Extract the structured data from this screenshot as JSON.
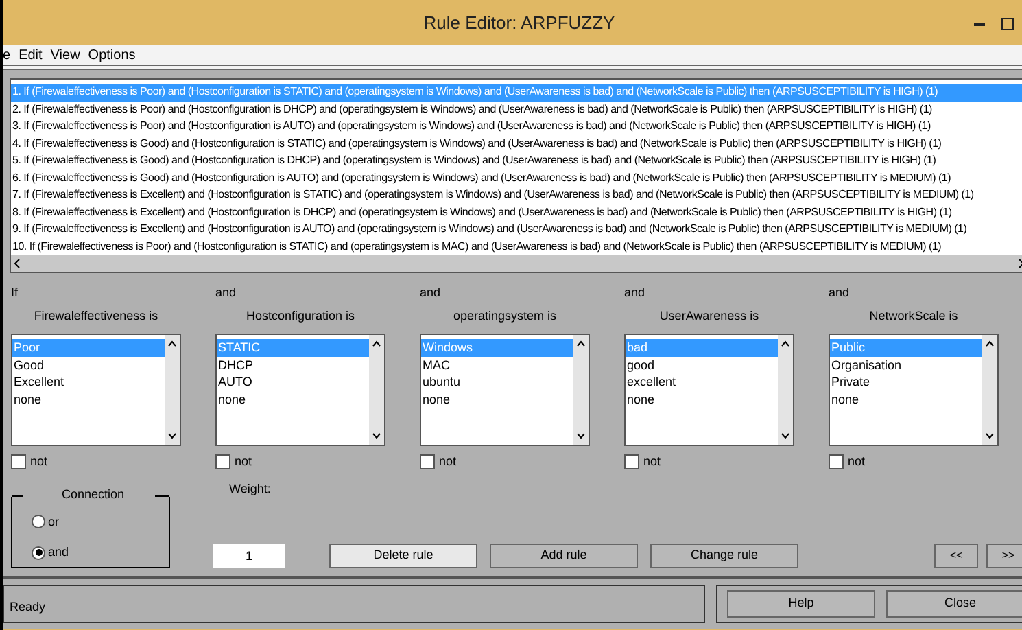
{
  "window": {
    "title": "Rule Editor: ARPFUZZY"
  },
  "menu": [
    "e",
    "Edit",
    "View",
    "Options"
  ],
  "rules": [
    {
      "text": "1. If (Firewaleffectiveness is Poor) and (Hostconfiguration is STATIC) and (operatingsystem is Windows) and (UserAwareness is bad) and (NetworkScale is Public) then (ARPSUSCEPTIBILITY is HIGH) (1)",
      "selected": true
    },
    {
      "text": "2. If (Firewaleffectiveness is Poor) and (Hostconfiguration is DHCP) and (operatingsystem is Windows) and (UserAwareness is bad) and (NetworkScale is Public) then (ARPSUSCEPTIBILITY is HIGH) (1)",
      "selected": false
    },
    {
      "text": "3. If (Firewaleffectiveness is Poor) and (Hostconfiguration is AUTO) and (operatingsystem is Windows) and (UserAwareness is bad) and (NetworkScale is Public) then (ARPSUSCEPTIBILITY is HIGH) (1)",
      "selected": false
    },
    {
      "text": "4. If (Firewaleffectiveness is Good) and (Hostconfiguration is STATIC) and (operatingsystem is Windows) and (UserAwareness is bad) and (NetworkScale is Public) then (ARPSUSCEPTIBILITY is HIGH) (1)",
      "selected": false
    },
    {
      "text": "5. If (Firewaleffectiveness is Good) and (Hostconfiguration is DHCP) and (operatingsystem is Windows) and (UserAwareness is bad) and (NetworkScale is Public) then (ARPSUSCEPTIBILITY is HIGH) (1)",
      "selected": false
    },
    {
      "text": "6. If (Firewaleffectiveness is Good) and (Hostconfiguration is AUTO) and (operatingsystem is Windows) and (UserAwareness is bad) and (NetworkScale is Public) then (ARPSUSCEPTIBILITY is MEDIUM) (1)",
      "selected": false
    },
    {
      "text": "7. If (Firewaleffectiveness is Excellent) and (Hostconfiguration is STATIC) and (operatingsystem is Windows) and (UserAwareness is bad) and (NetworkScale is Public) then (ARPSUSCEPTIBILITY is MEDIUM) (1)",
      "selected": false
    },
    {
      "text": "8. If (Firewaleffectiveness is Excellent) and (Hostconfiguration is DHCP) and (operatingsystem is Windows) and (UserAwareness is bad) and (NetworkScale is Public) then (ARPSUSCEPTIBILITY is HIGH) (1)",
      "selected": false
    },
    {
      "text": "9. If (Firewaleffectiveness is Excellent) and (Hostconfiguration is AUTO) and (operatingsystem is Windows) and (UserAwareness is bad) and (NetworkScale is Public) then (ARPSUSCEPTIBILITY is MEDIUM) (1)",
      "selected": false
    },
    {
      "text": "10. If (Firewaleffectiveness is Poor) and (Hostconfiguration is STATIC) and (operatingsystem is MAC) and (UserAwareness is bad) and (NetworkScale is Public) then (ARPSUSCEPTIBILITY is MEDIUM) (1)",
      "selected": false
    }
  ],
  "inputs": [
    {
      "connector": "If",
      "label": "Firewaleffectiveness is",
      "options": [
        {
          "text": "Poor",
          "selected": true
        },
        {
          "text": "Good",
          "selected": false
        },
        {
          "text": "Excellent",
          "selected": false
        },
        {
          "text": "none",
          "selected": false
        }
      ],
      "not_label": "not",
      "not_checked": false
    },
    {
      "connector": "and",
      "label": "Hostconfiguration is",
      "options": [
        {
          "text": "STATIC",
          "selected": true
        },
        {
          "text": "DHCP",
          "selected": false
        },
        {
          "text": "AUTO",
          "selected": false
        },
        {
          "text": "none",
          "selected": false
        }
      ],
      "not_label": "not",
      "not_checked": false
    },
    {
      "connector": "and",
      "label": "operatingsystem is",
      "options": [
        {
          "text": "Windows",
          "selected": true
        },
        {
          "text": "MAC",
          "selected": false
        },
        {
          "text": "ubuntu",
          "selected": false
        },
        {
          "text": "none",
          "selected": false
        }
      ],
      "not_label": "not",
      "not_checked": false
    },
    {
      "connector": "and",
      "label": "UserAwareness is",
      "options": [
        {
          "text": "bad",
          "selected": true
        },
        {
          "text": "good",
          "selected": false
        },
        {
          "text": "excellent",
          "selected": false
        },
        {
          "text": "none",
          "selected": false
        }
      ],
      "not_label": "not",
      "not_checked": false
    },
    {
      "connector": "and",
      "label": "NetworkScale is",
      "options": [
        {
          "text": "Public",
          "selected": true
        },
        {
          "text": "Organisation",
          "selected": false
        },
        {
          "text": "Private",
          "selected": false
        },
        {
          "text": "none",
          "selected": false
        }
      ],
      "not_label": "not",
      "not_checked": false
    }
  ],
  "connection": {
    "title": "Connection",
    "options": [
      {
        "label": "or",
        "selected": false
      },
      {
        "label": "and",
        "selected": true
      }
    ]
  },
  "weight": {
    "label": "Weight:",
    "value": "1"
  },
  "buttons": [
    "Delete rule",
    "Add rule",
    "Change rule"
  ],
  "nav": [
    "<<",
    ">>"
  ],
  "status_bar": "Ready",
  "footer_buttons": [
    "Help",
    "Close"
  ]
}
